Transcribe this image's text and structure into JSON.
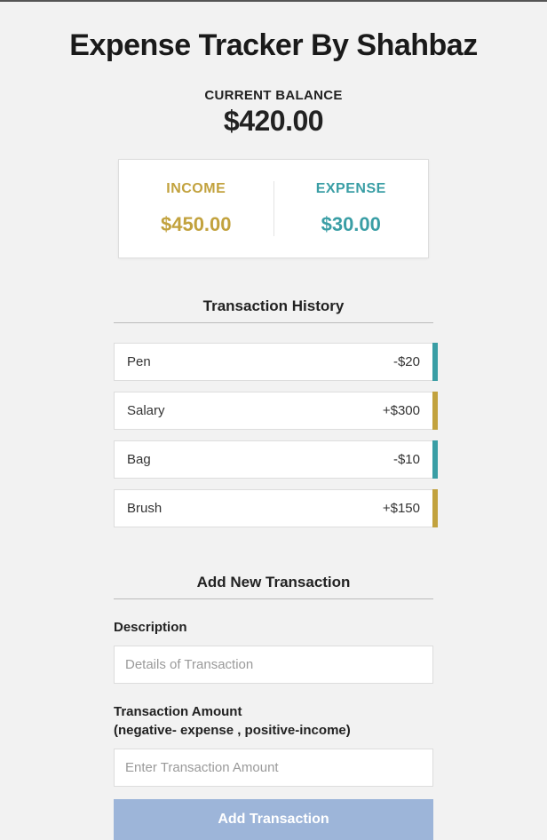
{
  "header": {
    "title": "Expense Tracker By Shahbaz"
  },
  "balance": {
    "label": "CURRENT BALANCE",
    "value": "$420.00"
  },
  "summary": {
    "income": {
      "label": "INCOME",
      "value": "$450.00"
    },
    "expense": {
      "label": "EXPENSE",
      "value": "$30.00"
    }
  },
  "history": {
    "heading": "Transaction History",
    "items": [
      {
        "name": "Pen",
        "amount": "-$20",
        "kind": "expense"
      },
      {
        "name": "Salary",
        "amount": "+$300",
        "kind": "income"
      },
      {
        "name": "Bag",
        "amount": "-$10",
        "kind": "expense"
      },
      {
        "name": "Brush",
        "amount": "+$150",
        "kind": "income"
      }
    ]
  },
  "form": {
    "heading": "Add New Transaction",
    "descLabel": "Description",
    "descPlaceholder": "Details of Transaction",
    "amountLabel": "Transaction Amount\n(negative- expense , positive-income)",
    "amountPlaceholder": "Enter Transaction Amount",
    "submit": "Add Transaction"
  }
}
